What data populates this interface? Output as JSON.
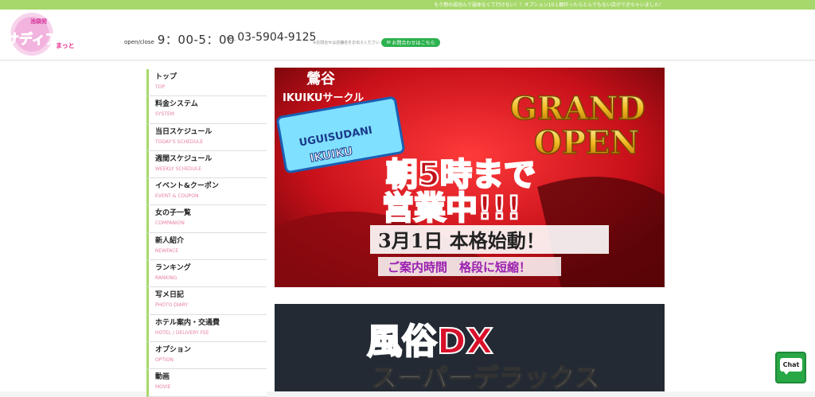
{
  "topbar": {
    "notice": "もう勢の成功んで弱体なくて行けない！！オプション10１鋼作ったらとんでもない店ができちゃいました！"
  },
  "header": {
    "logo": {
      "line1": "池袋発",
      "line2": "サディアン",
      "line3": "まっと"
    },
    "hours_label": "open/close",
    "hours_value": "9：00-5：00",
    "tel_label": "tel.",
    "tel_value": "03-5904-9125",
    "tel_note": "※お問合せは店舗名をお伝えください",
    "contact_button": "お問合わせはこちら"
  },
  "nav": {
    "items": [
      {
        "jp": "トップ",
        "en": "TOP"
      },
      {
        "jp": "料金システム",
        "en": "SYSTEM"
      },
      {
        "jp": "当日スケジュール",
        "en": "TODAY'S SCHEDULE"
      },
      {
        "jp": "週間スケジュール",
        "en": "WEEKLY SCHEDULE"
      },
      {
        "jp": "イベント&クーポン",
        "en": "EVENT & COUPON"
      },
      {
        "jp": "女の子一覧",
        "en": "COMPANION"
      },
      {
        "jp": "新人紹介",
        "en": "NEWFACE"
      },
      {
        "jp": "ランキング",
        "en": "RANKING"
      },
      {
        "jp": "写メ日記",
        "en": "PHOTO DIARY"
      },
      {
        "jp": "ホテル案内・交通費",
        "en": "HOTEL / DELIVERY FEE"
      },
      {
        "jp": "オプション",
        "en": "OPTION"
      },
      {
        "jp": "動画",
        "en": "MOVIE"
      }
    ]
  },
  "banner1": {
    "area": "鶯谷",
    "shop": "IKUIKUサークル",
    "shop_roman": "UGUISUDANI",
    "shop_sub": "IKUIKU",
    "grand": "GRAND",
    "open": "OPEN",
    "line1": "朝5時まで",
    "line2": "営業中!!!",
    "date": "3月1日 本格始動！",
    "note": "ご案内時間　格段に短縮！"
  },
  "banner2": {
    "title": "風俗DX",
    "subtitle": "スーパーデラックス"
  },
  "chat": {
    "label": "Chat"
  }
}
